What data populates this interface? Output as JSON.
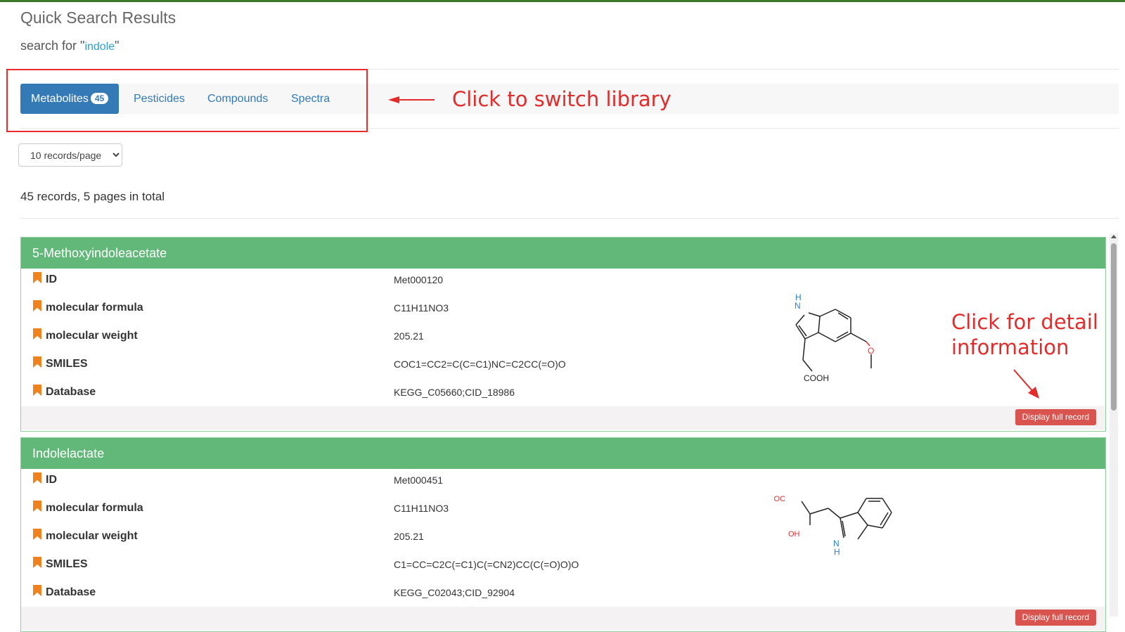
{
  "page": {
    "title": "Quick Search Results",
    "search_prefix": "search for \"",
    "search_term": "indole",
    "search_suffix": "\""
  },
  "tabs": [
    {
      "label": "Metabolites",
      "badge": "45"
    },
    {
      "label": "Pesticides"
    },
    {
      "label": "Compounds"
    },
    {
      "label": "Spectra"
    }
  ],
  "annotations": {
    "switch_library": "Click to switch library",
    "detail_line1": "Click for detail",
    "detail_line2": "information"
  },
  "pagination": {
    "selected": "10 records/page",
    "summary": "45 records, 5 pages in total"
  },
  "records": [
    {
      "name": "5-Methoxyindoleacetate",
      "fields": [
        {
          "label": "ID",
          "value": "Met000120"
        },
        {
          "label": "molecular formula",
          "value": "C11H11NO3"
        },
        {
          "label": "molecular weight",
          "value": "205.21"
        },
        {
          "label": "SMILES",
          "value": "COC1=CC2=C(C=C1)NC=C2CC(=O)O"
        },
        {
          "label": "Database",
          "value": "KEGG_C05660;CID_18986"
        }
      ],
      "structure_labels": {
        "nh": "N",
        "h": "H",
        "o": "O",
        "acid": "COOH"
      },
      "button": "Display full record"
    },
    {
      "name": "Indolelactate",
      "fields": [
        {
          "label": "ID",
          "value": "Met000451"
        },
        {
          "label": "molecular formula",
          "value": "C11H11NO3"
        },
        {
          "label": "molecular weight",
          "value": "205.21"
        },
        {
          "label": "SMILES",
          "value": "C1=CC=C2C(=C1)C(=CN2)CC(C(=O)O)O"
        },
        {
          "label": "Database",
          "value": "KEGG_C02043;CID_92904"
        }
      ],
      "structure_labels": {
        "acid": "HOOC",
        "oh": "OH",
        "n": "N",
        "h": "H"
      },
      "button": "Display full record"
    }
  ]
}
